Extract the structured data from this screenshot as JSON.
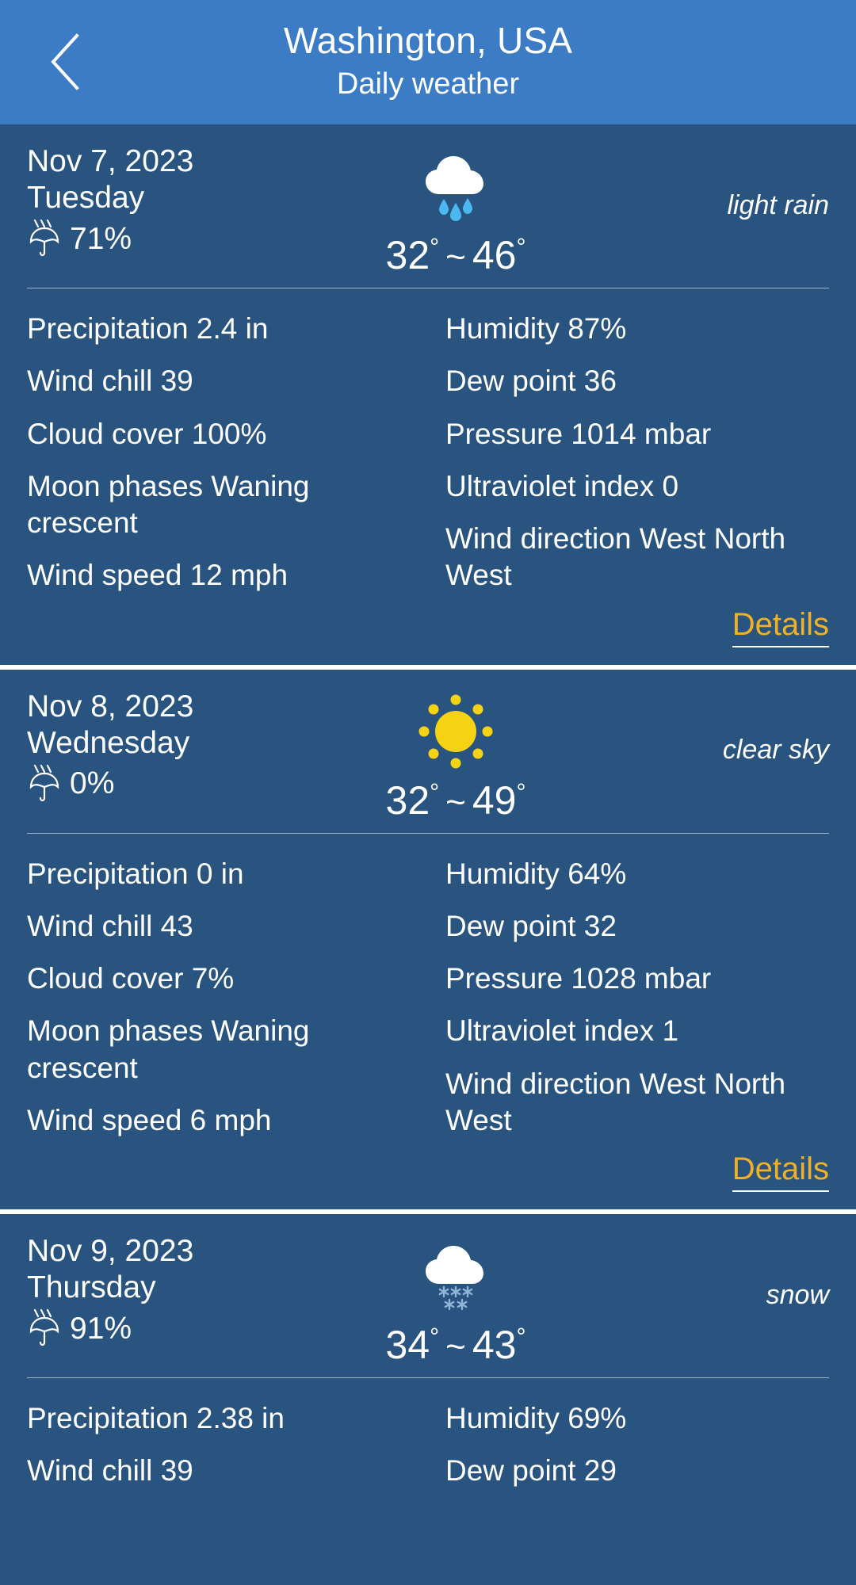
{
  "header": {
    "back_icon": "chevron-left-icon",
    "title": "Washington, USA",
    "subtitle": "Daily weather"
  },
  "labels": {
    "details": "Details",
    "tilde": "~",
    "degree": "°"
  },
  "colors": {
    "appbar": "#3b7cc4",
    "card": "#2a5480",
    "accent": "#f2b124",
    "text": "#ffffff",
    "sun": "#f5d313",
    "raindrop": "#4bb8ef",
    "snowflake": "#8fb4d4"
  },
  "days": [
    {
      "date": "Nov 7, 2023",
      "weekday": "Tuesday",
      "precip_chance": "71%",
      "icon": "rain-cloud-icon",
      "temp_low": "32",
      "temp_high": "46",
      "condition": "light rain",
      "stats_left": [
        "Precipitation 2.4 in",
        "Wind chill 39",
        "Cloud cover 100%",
        "Moon phases Waning crescent",
        "Wind speed 12 mph"
      ],
      "stats_right": [
        "Humidity 87%",
        "Dew point 36",
        "Pressure 1014 mbar",
        "Ultraviolet index 0",
        "Wind direction West North West"
      ]
    },
    {
      "date": "Nov 8, 2023",
      "weekday": "Wednesday",
      "precip_chance": "0%",
      "icon": "sun-icon",
      "temp_low": "32",
      "temp_high": "49",
      "condition": "clear sky",
      "stats_left": [
        "Precipitation 0 in",
        "Wind chill 43",
        "Cloud cover 7%",
        "Moon phases Waning crescent",
        "Wind speed 6 mph"
      ],
      "stats_right": [
        "Humidity 64%",
        "Dew point 32",
        "Pressure 1028 mbar",
        "Ultraviolet index 1",
        "Wind direction West North West"
      ]
    },
    {
      "date": "Nov 9, 2023",
      "weekday": "Thursday",
      "precip_chance": "91%",
      "icon": "snow-cloud-icon",
      "temp_low": "34",
      "temp_high": "43",
      "condition": "snow",
      "stats_left": [
        "Precipitation 2.38 in",
        "Wind chill 39"
      ],
      "stats_right": [
        "Humidity 69%",
        "Dew point 29"
      ]
    }
  ]
}
